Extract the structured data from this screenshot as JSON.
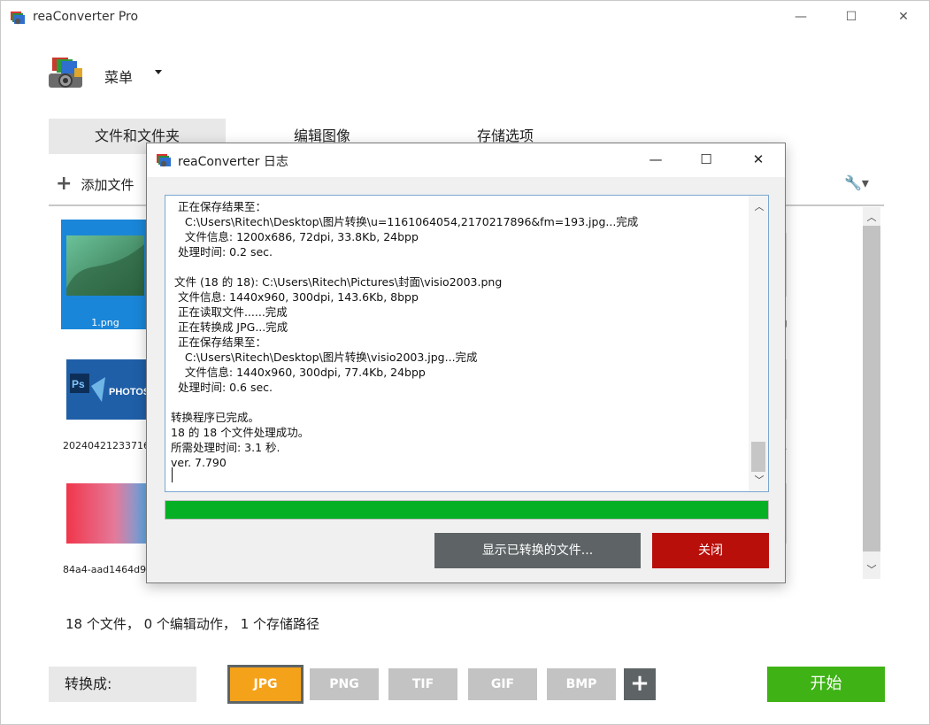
{
  "app": {
    "title": "reaConverter Pro",
    "menu_label": "菜单"
  },
  "tabs": [
    {
      "label": "文件和文件夹",
      "active": true
    },
    {
      "label": "编辑图像",
      "active": false
    },
    {
      "label": "存储选项",
      "active": false
    }
  ],
  "toolbar": {
    "add_files_label": "添加文件"
  },
  "files": [
    {
      "label": "1.png",
      "selected": true
    },
    {
      "label": "20240421233716",
      "selected": false
    },
    {
      "label": "84a4-aad1464d9",
      "selected": false
    }
  ],
  "right_column_partial": [
    "g",
    "..."
  ],
  "status": {
    "summary": "18 个文件， 0 个编辑动作， 1 个存储路径"
  },
  "bottom": {
    "convert_to_label": "转换成:",
    "formats": [
      {
        "label": "JPG",
        "active": true
      },
      {
        "label": "PNG",
        "active": false
      },
      {
        "label": "TIF",
        "active": false
      },
      {
        "label": "GIF",
        "active": false
      },
      {
        "label": "BMP",
        "active": false
      }
    ],
    "add_format_label": "+",
    "start_label": "开始"
  },
  "dialog": {
    "title": "reaConverter 日志",
    "log_lines": [
      "  正在保存结果至：",
      "    C:\\Users\\Ritech\\Desktop\\图片转换\\u=1161064054,2170217896&fm=193.jpg...完成",
      "    文件信息: 1200x686, 72dpi, 33.8Kb, 24bpp",
      "  处理时间: 0.2 sec.",
      "",
      " 文件 (18 的 18): C:\\Users\\Ritech\\Pictures\\封面\\visio2003.png",
      "  文件信息: 1440x960, 300dpi, 143.6Kb, 8bpp",
      "  正在读取文件......完成",
      "  正在转换成 JPG...完成",
      "  正在保存结果至：",
      "    C:\\Users\\Ritech\\Desktop\\图片转换\\visio2003.jpg...完成",
      "    文件信息: 1440x960, 300dpi, 77.4Kb, 24bpp",
      "  处理时间: 0.6 sec.",
      "",
      "转换程序已完成。",
      "18 的 18 个文件处理成功。",
      "所需处理时间: 3.1 秒.",
      "ver. 7.790"
    ],
    "progress_fraction": 1.0,
    "show_converted_label": "显示已转换的文件...",
    "close_label": "关闭"
  },
  "colors": {
    "accent_orange": "#f5a21b",
    "start_green": "#3fb316",
    "close_red": "#b80f0a",
    "progress_green": "#06b025",
    "selection_blue": "#1a86d9"
  }
}
